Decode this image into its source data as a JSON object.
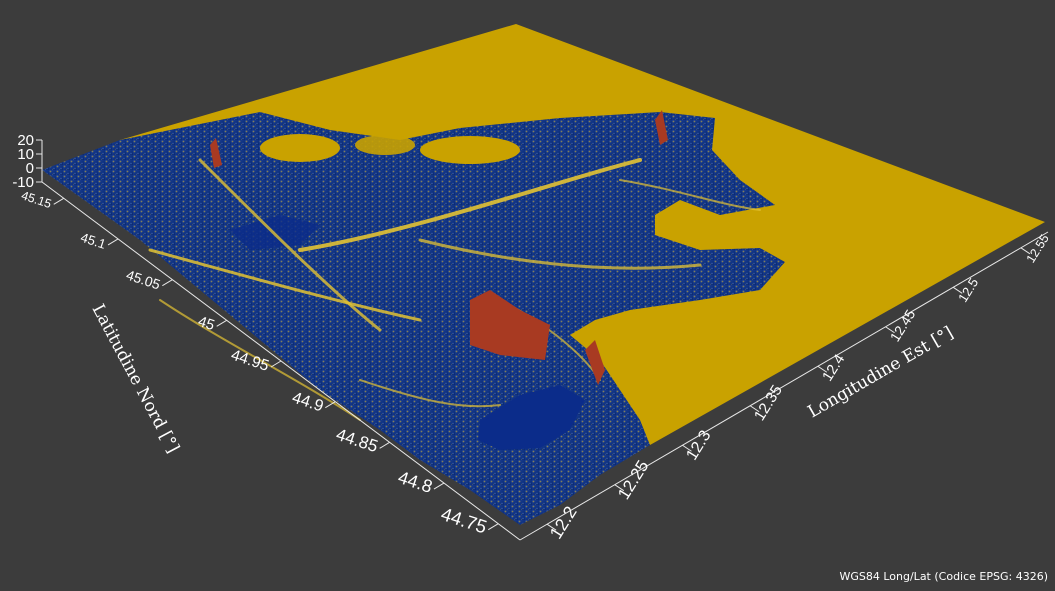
{
  "chart_data": {
    "type": "surface3d",
    "title": "",
    "xlabel": "Longitudine Est [°]",
    "ylabel": "Latitudine Nord [°]",
    "zlabel": "",
    "x_ticks": [
      "12.2",
      "12.25",
      "12.3",
      "12.35",
      "12.4",
      "12.45",
      "12.5",
      "12.55"
    ],
    "y_ticks": [
      "44.75",
      "44.8",
      "44.85",
      "44.9",
      "44.95",
      "45",
      "45.05",
      "45.1",
      "45.15"
    ],
    "z_ticks": [
      "-10",
      "0",
      "10",
      "20"
    ],
    "xlim": [
      12.18,
      12.57
    ],
    "ylim": [
      44.73,
      45.17
    ],
    "zlim": [
      -10,
      20
    ],
    "colors": {
      "sea": "#c9a200",
      "low": "#0a2a7a",
      "mid": "#1e4fa6",
      "edge": "#e0c030",
      "high": "#b04020",
      "background": "#3c3c3c"
    }
  },
  "footer": {
    "crs_note": "WGS84 Long/Lat (Codice EPSG: 4326)"
  }
}
